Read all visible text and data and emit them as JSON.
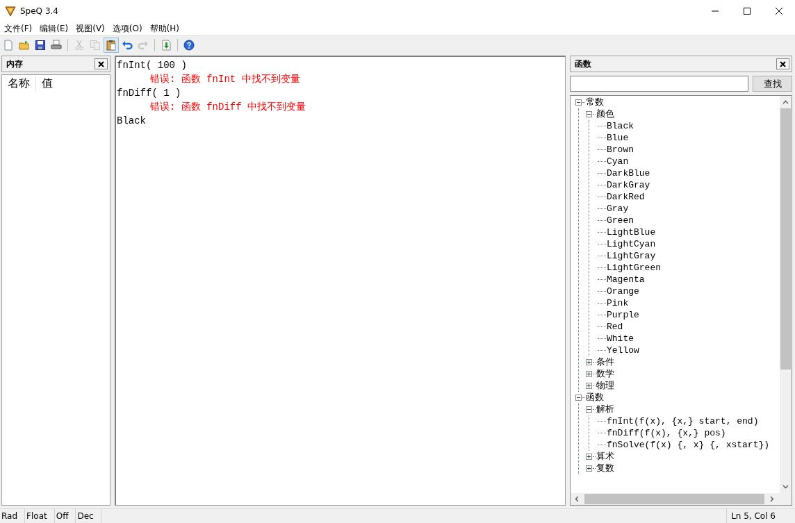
{
  "window": {
    "title": "SpeQ 3.4"
  },
  "menu": [
    "文件(F)",
    "编辑(E)",
    "视图(V)",
    "选项(O)",
    "帮助(H)"
  ],
  "toolbar": [
    {
      "kind": "new",
      "disabled": false,
      "pressed": false
    },
    {
      "kind": "open",
      "disabled": false,
      "pressed": false
    },
    {
      "kind": "save",
      "disabled": false,
      "pressed": false
    },
    {
      "kind": "print",
      "disabled": false,
      "pressed": false
    },
    {
      "kind": "separator"
    },
    {
      "kind": "cut",
      "disabled": true,
      "pressed": false
    },
    {
      "kind": "copy",
      "disabled": true,
      "pressed": false
    },
    {
      "kind": "paste",
      "disabled": false,
      "pressed": true
    },
    {
      "kind": "undo",
      "disabled": false,
      "pressed": false
    },
    {
      "kind": "redo",
      "disabled": true,
      "pressed": false
    },
    {
      "kind": "separator"
    },
    {
      "kind": "import",
      "disabled": false,
      "pressed": false
    },
    {
      "kind": "separator"
    },
    {
      "kind": "help",
      "disabled": false,
      "pressed": false
    }
  ],
  "memory_panel": {
    "title": "内存",
    "columns": [
      "名称",
      "值"
    ]
  },
  "editor": {
    "lines": [
      {
        "kind": "input",
        "text": "fnInt( 100 )"
      },
      {
        "kind": "error",
        "text": "错误: 函数 fnInt 中找不到变量"
      },
      {
        "kind": "input",
        "text": "fnDiff( 1 )"
      },
      {
        "kind": "error",
        "text": "错误: 函数 fnDiff 中找不到变量"
      },
      {
        "kind": "input",
        "text": "Black"
      }
    ]
  },
  "functions_panel": {
    "title": "函数",
    "search": {
      "button": "查找"
    },
    "tree": [
      {
        "label": "常数",
        "expanded": true,
        "children": [
          {
            "label": "颜色",
            "expanded": true,
            "children": [
              {
                "label": "Black"
              },
              {
                "label": "Blue"
              },
              {
                "label": "Brown"
              },
              {
                "label": "Cyan"
              },
              {
                "label": "DarkBlue"
              },
              {
                "label": "DarkGray"
              },
              {
                "label": "DarkRed"
              },
              {
                "label": "Gray"
              },
              {
                "label": "Green"
              },
              {
                "label": "LightBlue"
              },
              {
                "label": "LightCyan"
              },
              {
                "label": "LightGray"
              },
              {
                "label": "LightGreen"
              },
              {
                "label": "Magenta"
              },
              {
                "label": "Orange"
              },
              {
                "label": "Pink"
              },
              {
                "label": "Purple"
              },
              {
                "label": "Red"
              },
              {
                "label": "White"
              },
              {
                "label": "Yellow"
              }
            ]
          },
          {
            "label": "条件",
            "expanded": false
          },
          {
            "label": "数学",
            "expanded": false
          },
          {
            "label": "物理",
            "expanded": false
          }
        ]
      },
      {
        "label": "函数",
        "expanded": true,
        "children": [
          {
            "label": "解析",
            "expanded": true,
            "children": [
              {
                "label": "fnInt(f(x), {x,} start, end)"
              },
              {
                "label": "fnDiff(f(x), {x,} pos)"
              },
              {
                "label": "fnSolve(f(x) {, x} {, xstart})"
              }
            ]
          },
          {
            "label": "算术",
            "expanded": false
          },
          {
            "label": "复数",
            "expanded": false
          }
        ]
      }
    ]
  },
  "status_bar": {
    "cells": [
      "Rad",
      "Float",
      "Off",
      "Dec"
    ],
    "position": "Ln 5, Col 6"
  }
}
